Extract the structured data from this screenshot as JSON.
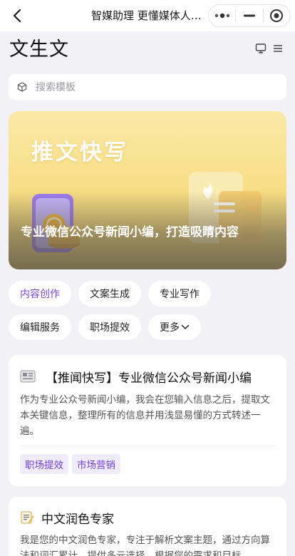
{
  "navbar": {
    "title": "智媒助理 更懂媒体人的…"
  },
  "header": {
    "title": "文生文"
  },
  "search": {
    "placeholder": "搜索模板"
  },
  "banner": {
    "headline": "推文快写",
    "caption": "专业微信公众号新闻小编，打造吸睛内容"
  },
  "categories": [
    {
      "label": "内容创作",
      "active": true
    },
    {
      "label": "文案生成",
      "active": false
    },
    {
      "label": "专业写作",
      "active": false
    },
    {
      "label": "编辑服务",
      "active": false
    },
    {
      "label": "职场提效",
      "active": false
    },
    {
      "label": "更多",
      "active": false
    }
  ],
  "cards": [
    {
      "icon": "newspaper-icon",
      "title": "【推闻快写】专业微信公众号新闻小编",
      "description": "作为专业公众号新闻小编，我会在您输入信息之后，提取文本关键信息，整理所有的信息并用浅显易懂的方式转述一遍。",
      "tags": [
        "职场提效",
        "市场营销"
      ]
    },
    {
      "icon": "memo-icon",
      "title": "中文润色专家",
      "description": "我是您的中文润色专家，专注于解析文案主题，通过方向算法和词汇累计，提供多元选择，根据您的需求和目标"
    }
  ],
  "colors": {
    "accent": "#7a45d8",
    "tag_bg": "#f1ecfb",
    "page_bg": "#f1f1f6",
    "banner": "#f6dc82"
  }
}
